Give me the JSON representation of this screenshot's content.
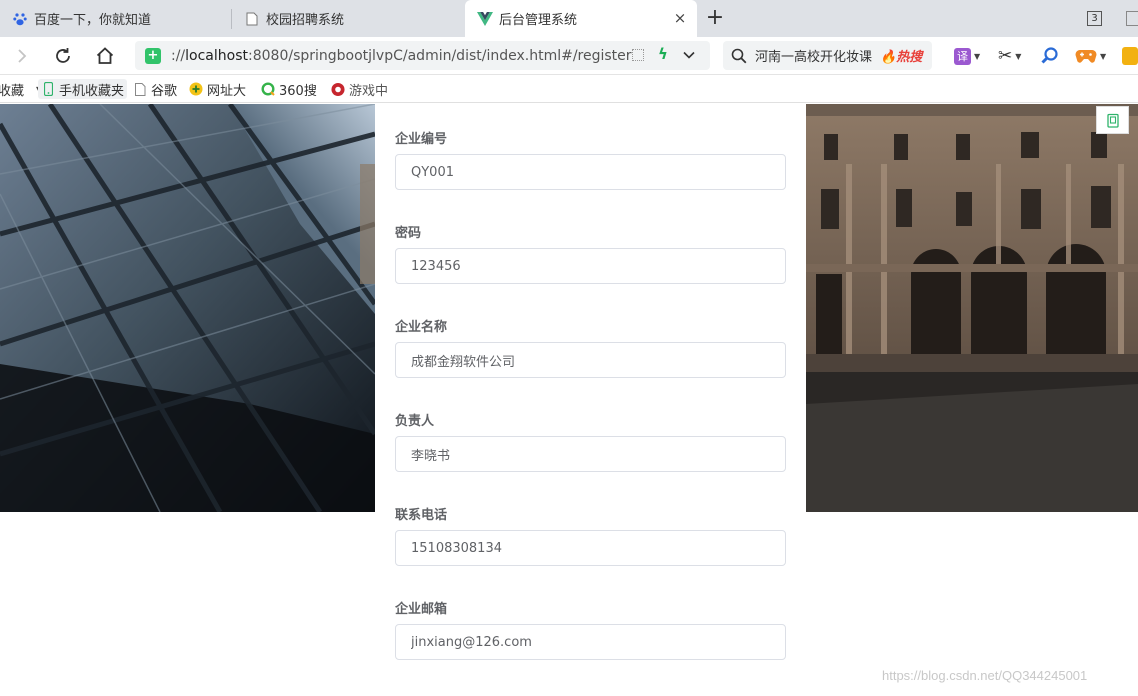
{
  "browser": {
    "tabs": [
      {
        "title": "百度一下，你就知道",
        "icon": "baidu-paw-icon"
      },
      {
        "title": "校园招聘系统",
        "icon": "page-icon"
      },
      {
        "title": "后台管理系统",
        "icon": "vue-logo-icon",
        "active": true
      }
    ],
    "tab_count": "3",
    "address": {
      "url_prefix": "://",
      "url_host": "localhost",
      "url_rest": ":8080/springbootjlvpC/admin/dist/index.html#/register"
    },
    "search": {
      "text": "河南一高校开化妆课",
      "hot_label": "热搜"
    },
    "extensions": {
      "translate_label": "译"
    },
    "bookmarks": [
      {
        "label": "收藏",
        "icon": "star-icon"
      },
      {
        "label": "手机收藏夹",
        "icon": "phone-icon"
      },
      {
        "label": "谷歌",
        "icon": "page-icon"
      },
      {
        "label": "网址大",
        "icon": "globe-icon"
      },
      {
        "label": "360搜",
        "icon": "360-search-icon"
      },
      {
        "label": "游戏中",
        "icon": "game-icon"
      }
    ]
  },
  "form": {
    "fields": [
      {
        "label": "企业编号",
        "value": "QY001"
      },
      {
        "label": "密码",
        "value": "123456"
      },
      {
        "label": "企业名称",
        "value": "成都金翔软件公司"
      },
      {
        "label": "负责人",
        "value": "李晓书"
      },
      {
        "label": "联系电话",
        "value": "15108308134"
      },
      {
        "label": "企业邮箱",
        "value": "jinxiang@126.com"
      }
    ]
  },
  "watermark": "https://blog.csdn.net/QQ344245001"
}
